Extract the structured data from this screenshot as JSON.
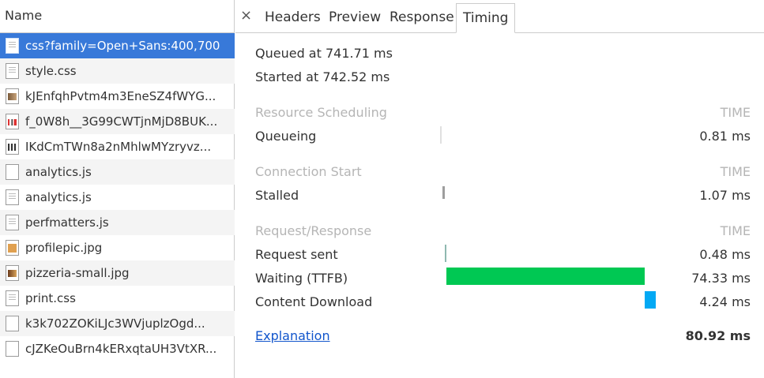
{
  "left_panel": {
    "header": "Name",
    "files": [
      {
        "name": "css?family=Open+Sans:400,700",
        "icon": "doc",
        "selected": true
      },
      {
        "name": "style.css",
        "icon": "doc"
      },
      {
        "name": "kJEnfqhPvtm4m3EneSZ4fWYG...",
        "icon": "img"
      },
      {
        "name": "f_0W8h__3G99CWTjnMjD8BUK...",
        "icon": "chart"
      },
      {
        "name": "IKdCmTWn8a2nMhlwMYzryvz...",
        "icon": "grid"
      },
      {
        "name": "analytics.js",
        "icon": "blank"
      },
      {
        "name": "analytics.js",
        "icon": "doc"
      },
      {
        "name": "perfmatters.js",
        "icon": "doc"
      },
      {
        "name": "profilepic.jpg",
        "icon": "pic"
      },
      {
        "name": "pizzeria-small.jpg",
        "icon": "pizza"
      },
      {
        "name": "print.css",
        "icon": "doc"
      },
      {
        "name": "k3k702ZOKiLJc3WVjuplzOgd...",
        "icon": "blank"
      },
      {
        "name": "cJZKeOuBrn4kERxqtaUH3VtXR...",
        "icon": "blank"
      }
    ]
  },
  "tabs": {
    "close": "×",
    "items": [
      "Headers",
      "Preview",
      "Response",
      "Timing"
    ],
    "active": "Timing"
  },
  "timing": {
    "queued": "Queued at 741.71 ms",
    "started": "Started at 742.52 ms",
    "time_label": "TIME",
    "sections": {
      "scheduling": "Resource Scheduling",
      "connection": "Connection Start",
      "request": "Request/Response"
    },
    "rows": {
      "queueing": {
        "label": "Queueing",
        "value": "0.81 ms"
      },
      "stalled": {
        "label": "Stalled",
        "value": "1.07 ms"
      },
      "request_sent": {
        "label": "Request sent",
        "value": "0.48 ms"
      },
      "waiting": {
        "label": "Waiting (TTFB)",
        "value": "74.33 ms"
      },
      "download": {
        "label": "Content Download",
        "value": "4.24 ms"
      }
    },
    "explanation": "Explanation",
    "total": "80.92 ms"
  },
  "colors": {
    "selected_row": "#3879d9",
    "waiting_bar": "#00c853",
    "download_bar": "#03a9f4",
    "section_text": "#b5b5b5",
    "link": "#1155cc"
  }
}
